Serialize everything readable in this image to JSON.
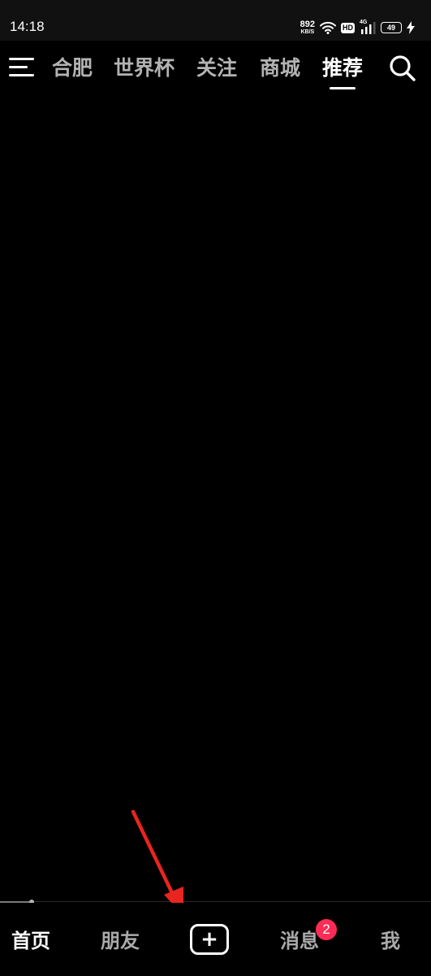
{
  "status_bar": {
    "time": "14:18",
    "net_speed": {
      "value": "892",
      "unit": "KB/S"
    },
    "hd_label": "HD",
    "signal_label": "4G",
    "battery_level": "49",
    "icons": [
      "wifi-icon",
      "signal-icon",
      "battery-icon",
      "charging-icon"
    ]
  },
  "top_nav": {
    "menu_icon": "menu-icon",
    "tabs": [
      {
        "label": "合肥",
        "active": false
      },
      {
        "label": "世界杯",
        "active": false
      },
      {
        "label": "关注",
        "active": false
      },
      {
        "label": "商城",
        "active": false
      },
      {
        "label": "推荐",
        "active": true
      }
    ],
    "search_icon": "search-icon"
  },
  "player": {
    "progress": 0.073
  },
  "bottom_nav": {
    "items": [
      {
        "label": "首页",
        "active": true
      },
      {
        "label": "朋友",
        "active": false
      },
      {
        "label": "+",
        "type": "create"
      },
      {
        "label": "消息",
        "active": false,
        "badge": "2"
      },
      {
        "label": "我",
        "active": false
      }
    ]
  },
  "colors": {
    "background": "#000000",
    "active_text": "#ffffff",
    "inactive_text": "#b3b3b3",
    "badge": "#fe2c55",
    "annotation_arrow": "#e8251f"
  }
}
